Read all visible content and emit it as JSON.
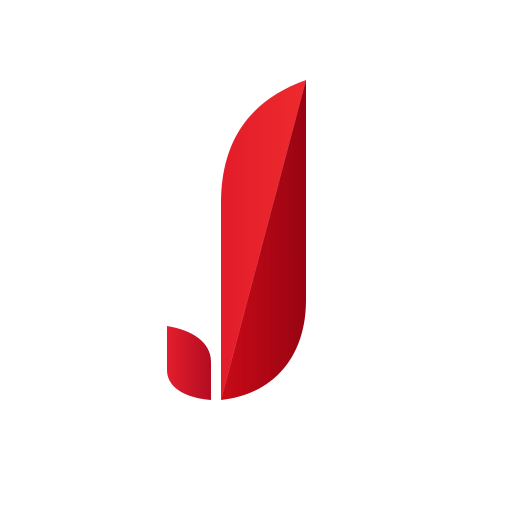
{
  "logo": {
    "icon": "letter-j-logo-icon",
    "colors": {
      "primary": "#E41E2B",
      "light": "#EE2A2E",
      "dark": "#9E0410",
      "shadow": "#C8102A",
      "background": "#FFFFFF"
    }
  }
}
